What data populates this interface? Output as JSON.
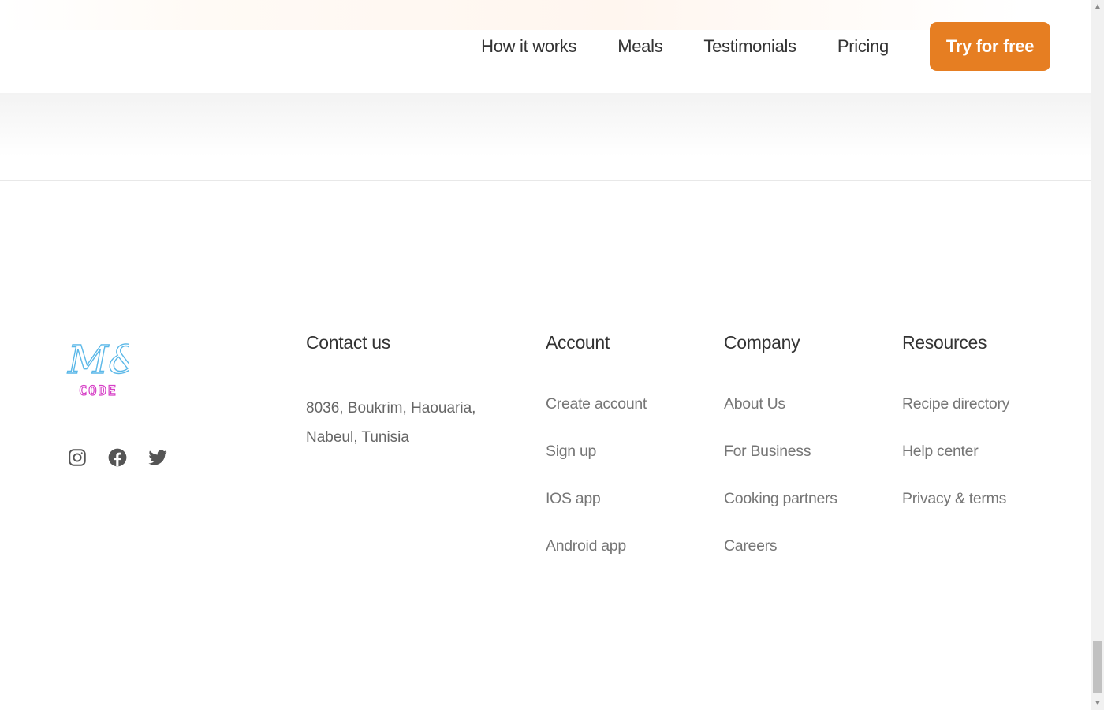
{
  "header": {
    "nav": [
      {
        "label": "How it works"
      },
      {
        "label": "Meals"
      },
      {
        "label": "Testimonials"
      },
      {
        "label": "Pricing"
      }
    ],
    "cta_label": "Try for free",
    "accent_color": "#e67e22"
  },
  "footer": {
    "logo": {
      "script_text": "M&",
      "sub_text": "CODE"
    },
    "socials": [
      {
        "icon": "instagram-icon"
      },
      {
        "icon": "facebook-icon"
      },
      {
        "icon": "twitter-icon"
      }
    ],
    "contact": {
      "title": "Contact us",
      "address_line1": "8036, Boukrim, Haouaria,",
      "address_line2": "Nabeul, Tunisia"
    },
    "account": {
      "title": "Account",
      "links": [
        "Create account",
        "Sign up",
        "IOS app",
        "Android app"
      ]
    },
    "company": {
      "title": "Company",
      "links": [
        "About Us",
        "For Business",
        "Cooking partners",
        "Careers"
      ]
    },
    "resources": {
      "title": "Resources",
      "links": [
        "Recipe directory",
        "Help center",
        "Privacy & terms"
      ]
    }
  }
}
